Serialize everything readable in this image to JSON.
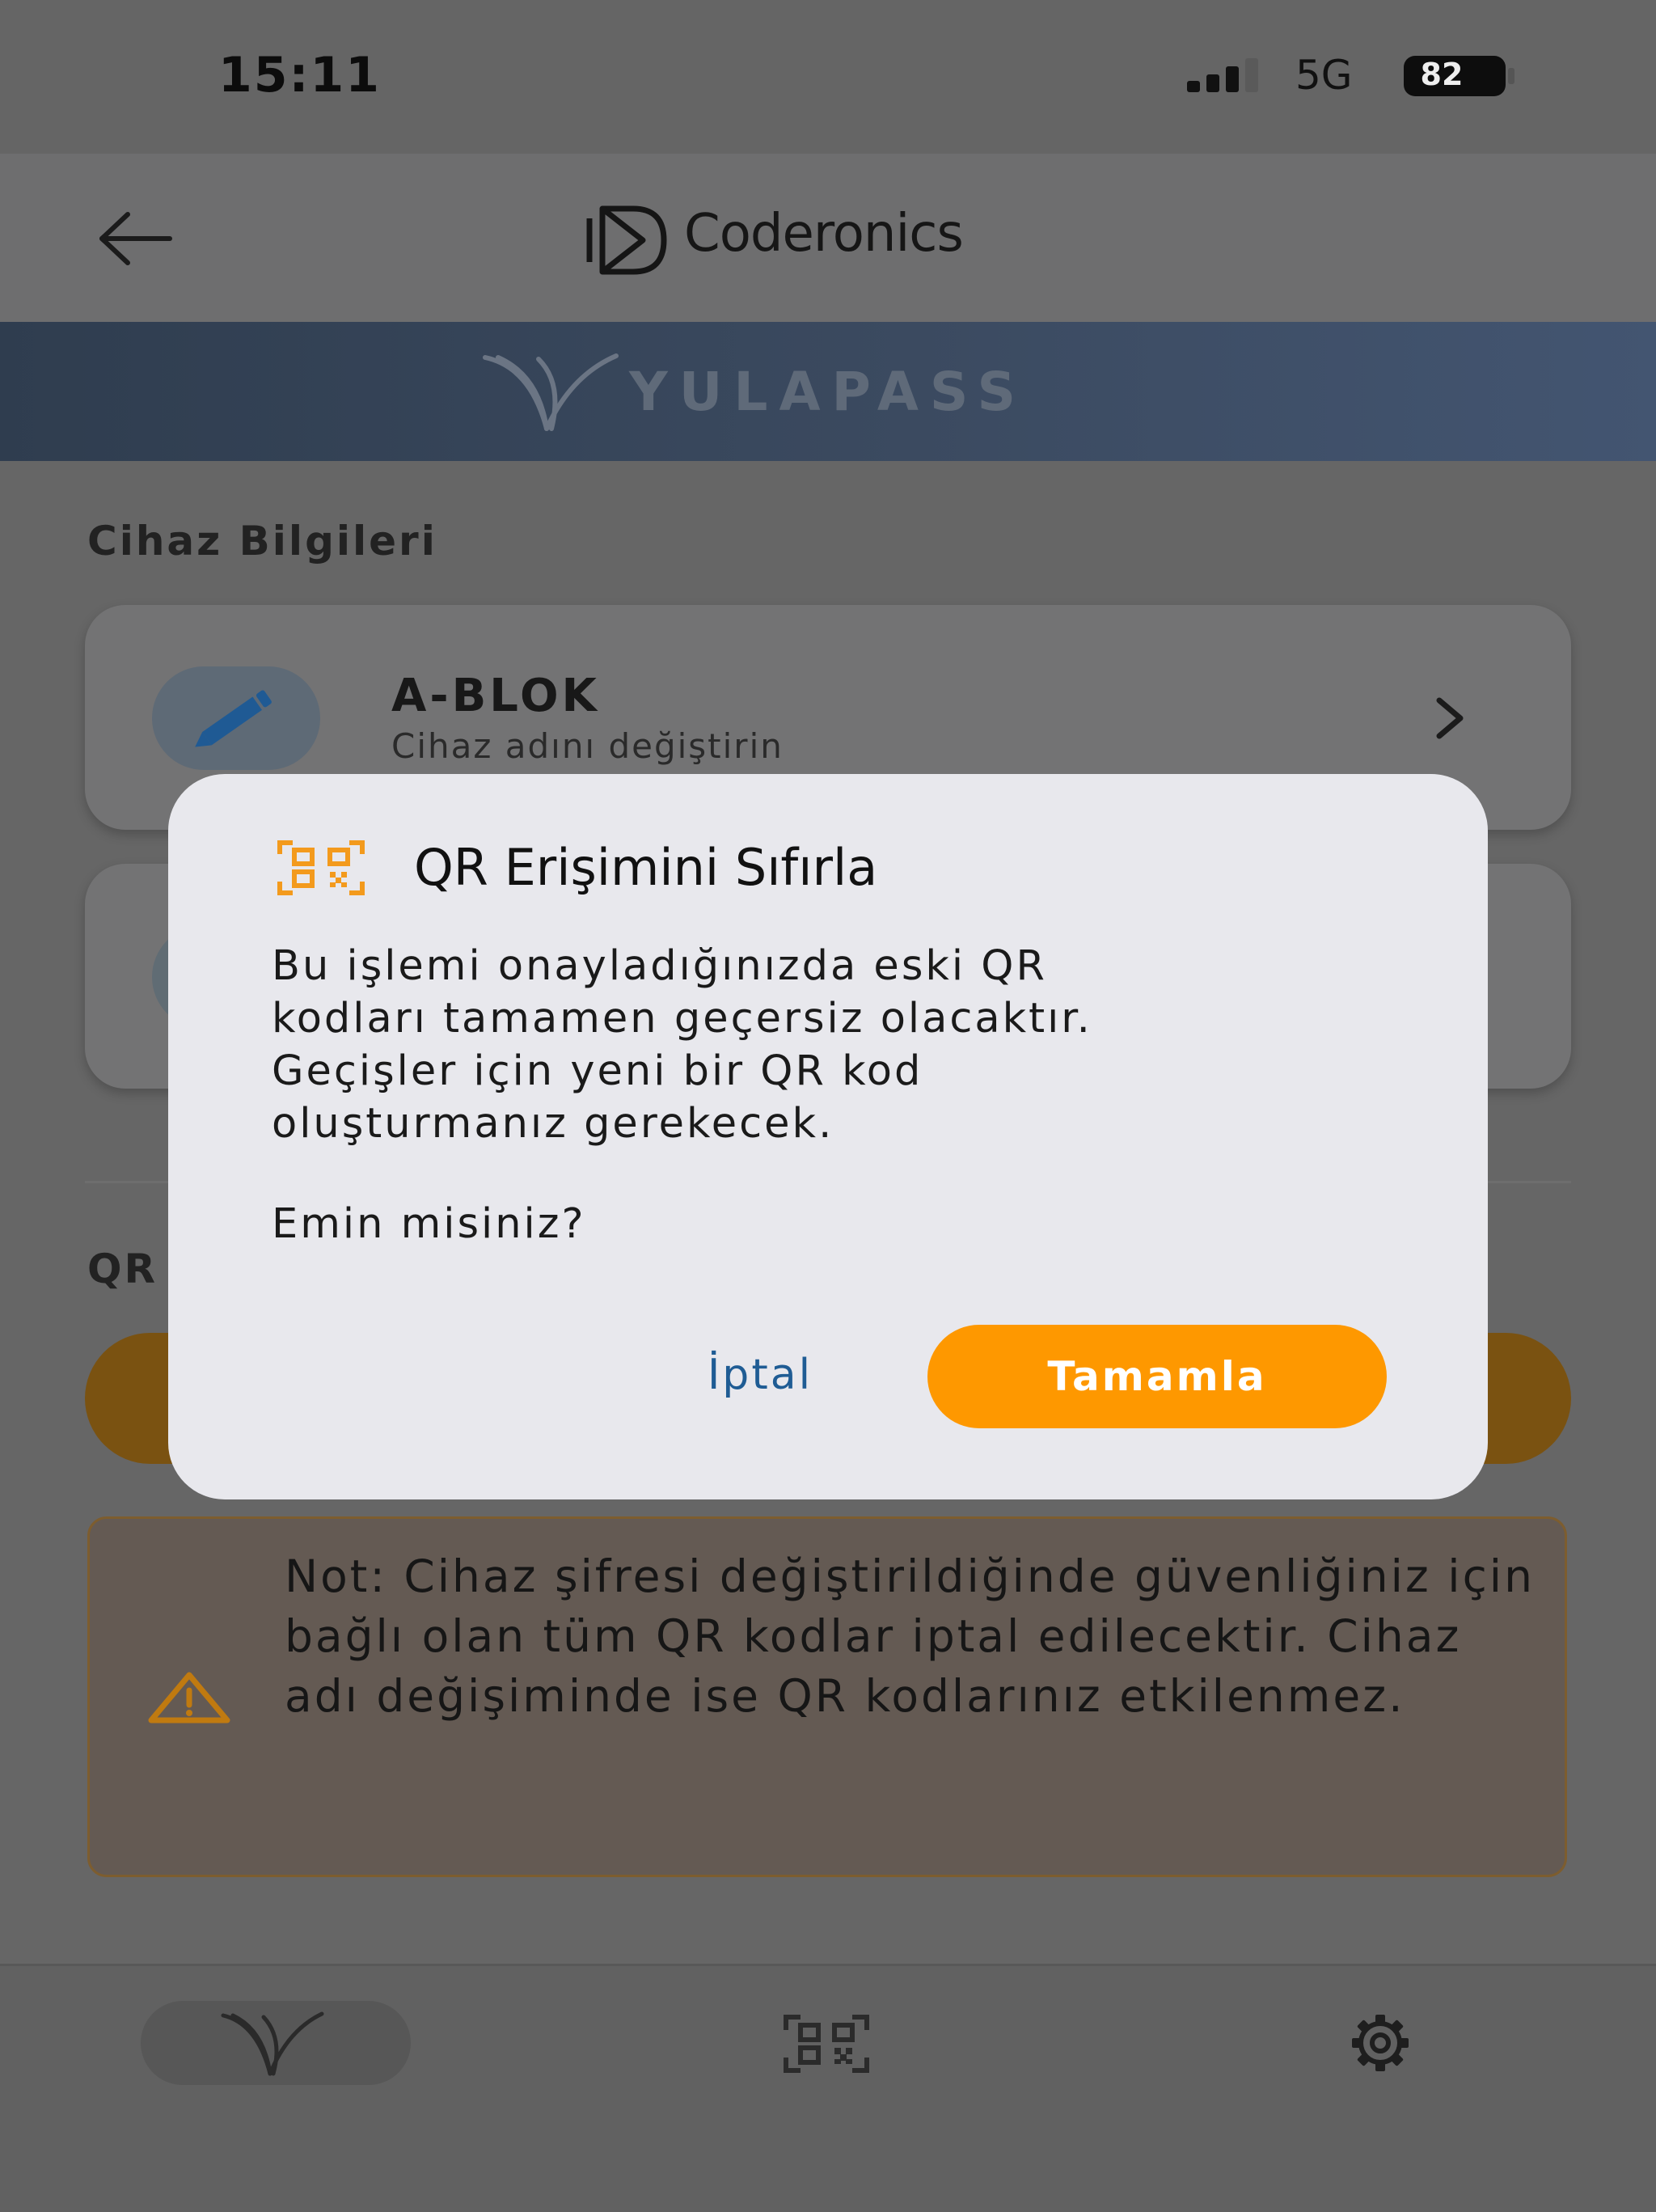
{
  "status_bar": {
    "time": "15:11",
    "network": "5G",
    "battery": "82"
  },
  "header": {
    "brand": "Coderonics"
  },
  "banner": {
    "title": "YULAPASS"
  },
  "device_section": {
    "title": "Cihaz Bilgileri",
    "device_name": "A-BLOK",
    "device_subtitle": "Cihaz adını değiştirin"
  },
  "qr_section": {
    "title": "QR"
  },
  "note": {
    "text": "Not: Cihaz şifresi değiştirildiğinde güvenliğiniz için bağlı olan tüm QR kodlar iptal edilecektir. Cihaz adı değişiminde ise QR kodlarınız etkilenmez."
  },
  "dialog": {
    "title": "QR Erişimini Sıfırla",
    "message": "Bu işlemi onayladığınızda eski QR\nkodları tamamen geçersiz olacaktır.\nGeçişler için yeni bir QR kod\noluşturmanız gerekecek.",
    "question": "Emin misiniz?",
    "cancel_label": "İptal",
    "confirm_label": "Tamamla"
  },
  "colors": {
    "accent": "#fe9800",
    "cancel_text": "#1f5c94",
    "banner": "#3b4a60",
    "dialog_bg": "#e8e8ed"
  },
  "icons": {
    "back": "arrow-left-icon",
    "edit": "pencil-icon",
    "chevron": "chevron-right-icon",
    "warning": "warning-triangle-icon",
    "qr": "qr-code-icon",
    "settings": "gear-icon",
    "home": "yulapass-logo-icon"
  }
}
